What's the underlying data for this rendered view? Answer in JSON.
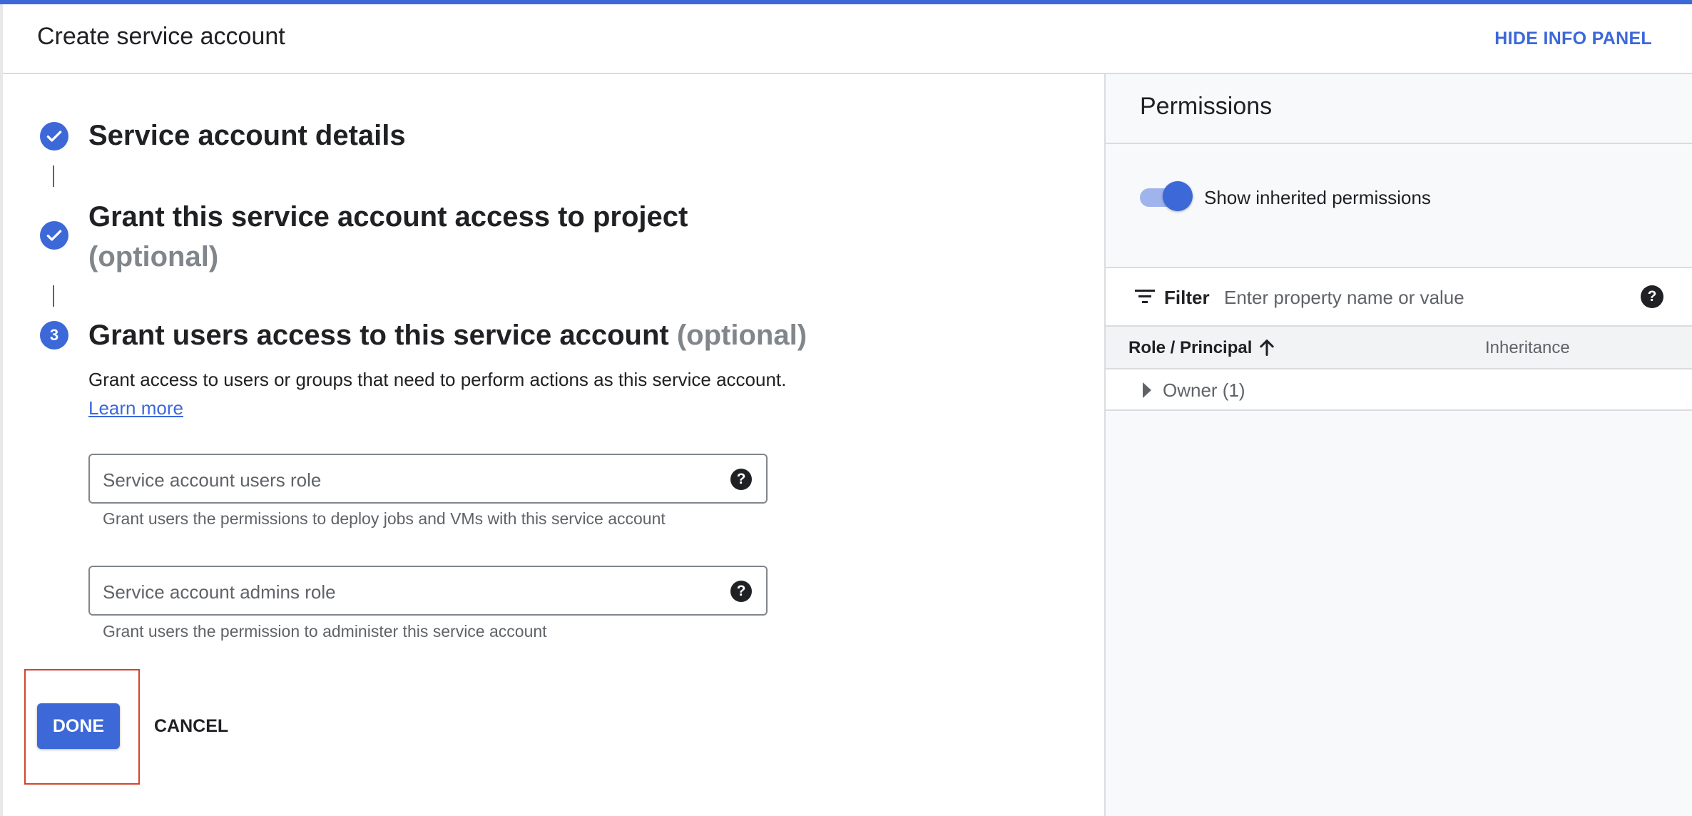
{
  "header": {
    "title": "Create service account",
    "hide_panel_label": "HIDE INFO PANEL"
  },
  "steps": [
    {
      "title": "Service account details",
      "state": "complete",
      "icon": "check-icon"
    },
    {
      "title": "Grant this service account access to project",
      "optional": "(optional)",
      "state": "complete",
      "icon": "check-icon"
    },
    {
      "title": "Grant users access to this service account",
      "optional": "(optional)",
      "state": "active",
      "number": "3"
    }
  ],
  "step3": {
    "description": "Grant access to users or groups that need to perform actions as this service account.",
    "learn_more": "Learn more",
    "users_role": {
      "placeholder": "Service account users role",
      "hint": "Grant users the permissions to deploy jobs and VMs with this service account"
    },
    "admins_role": {
      "placeholder": "Service account admins role",
      "hint": "Grant users the permission to administer this service account"
    }
  },
  "actions": {
    "done": "DONE",
    "cancel": "CANCEL"
  },
  "panel": {
    "title": "Permissions",
    "toggle_label": "Show inherited permissions",
    "toggle_on": true,
    "filter_label": "Filter",
    "filter_placeholder": "Enter property name or value",
    "help_glyph": "?",
    "columns": {
      "role": "Role / Principal",
      "inheritance": "Inheritance"
    },
    "rows": [
      {
        "label": "Owner (1)"
      }
    ]
  },
  "colors": {
    "accent": "#3c68d8",
    "highlight_box": "#d2452d"
  }
}
